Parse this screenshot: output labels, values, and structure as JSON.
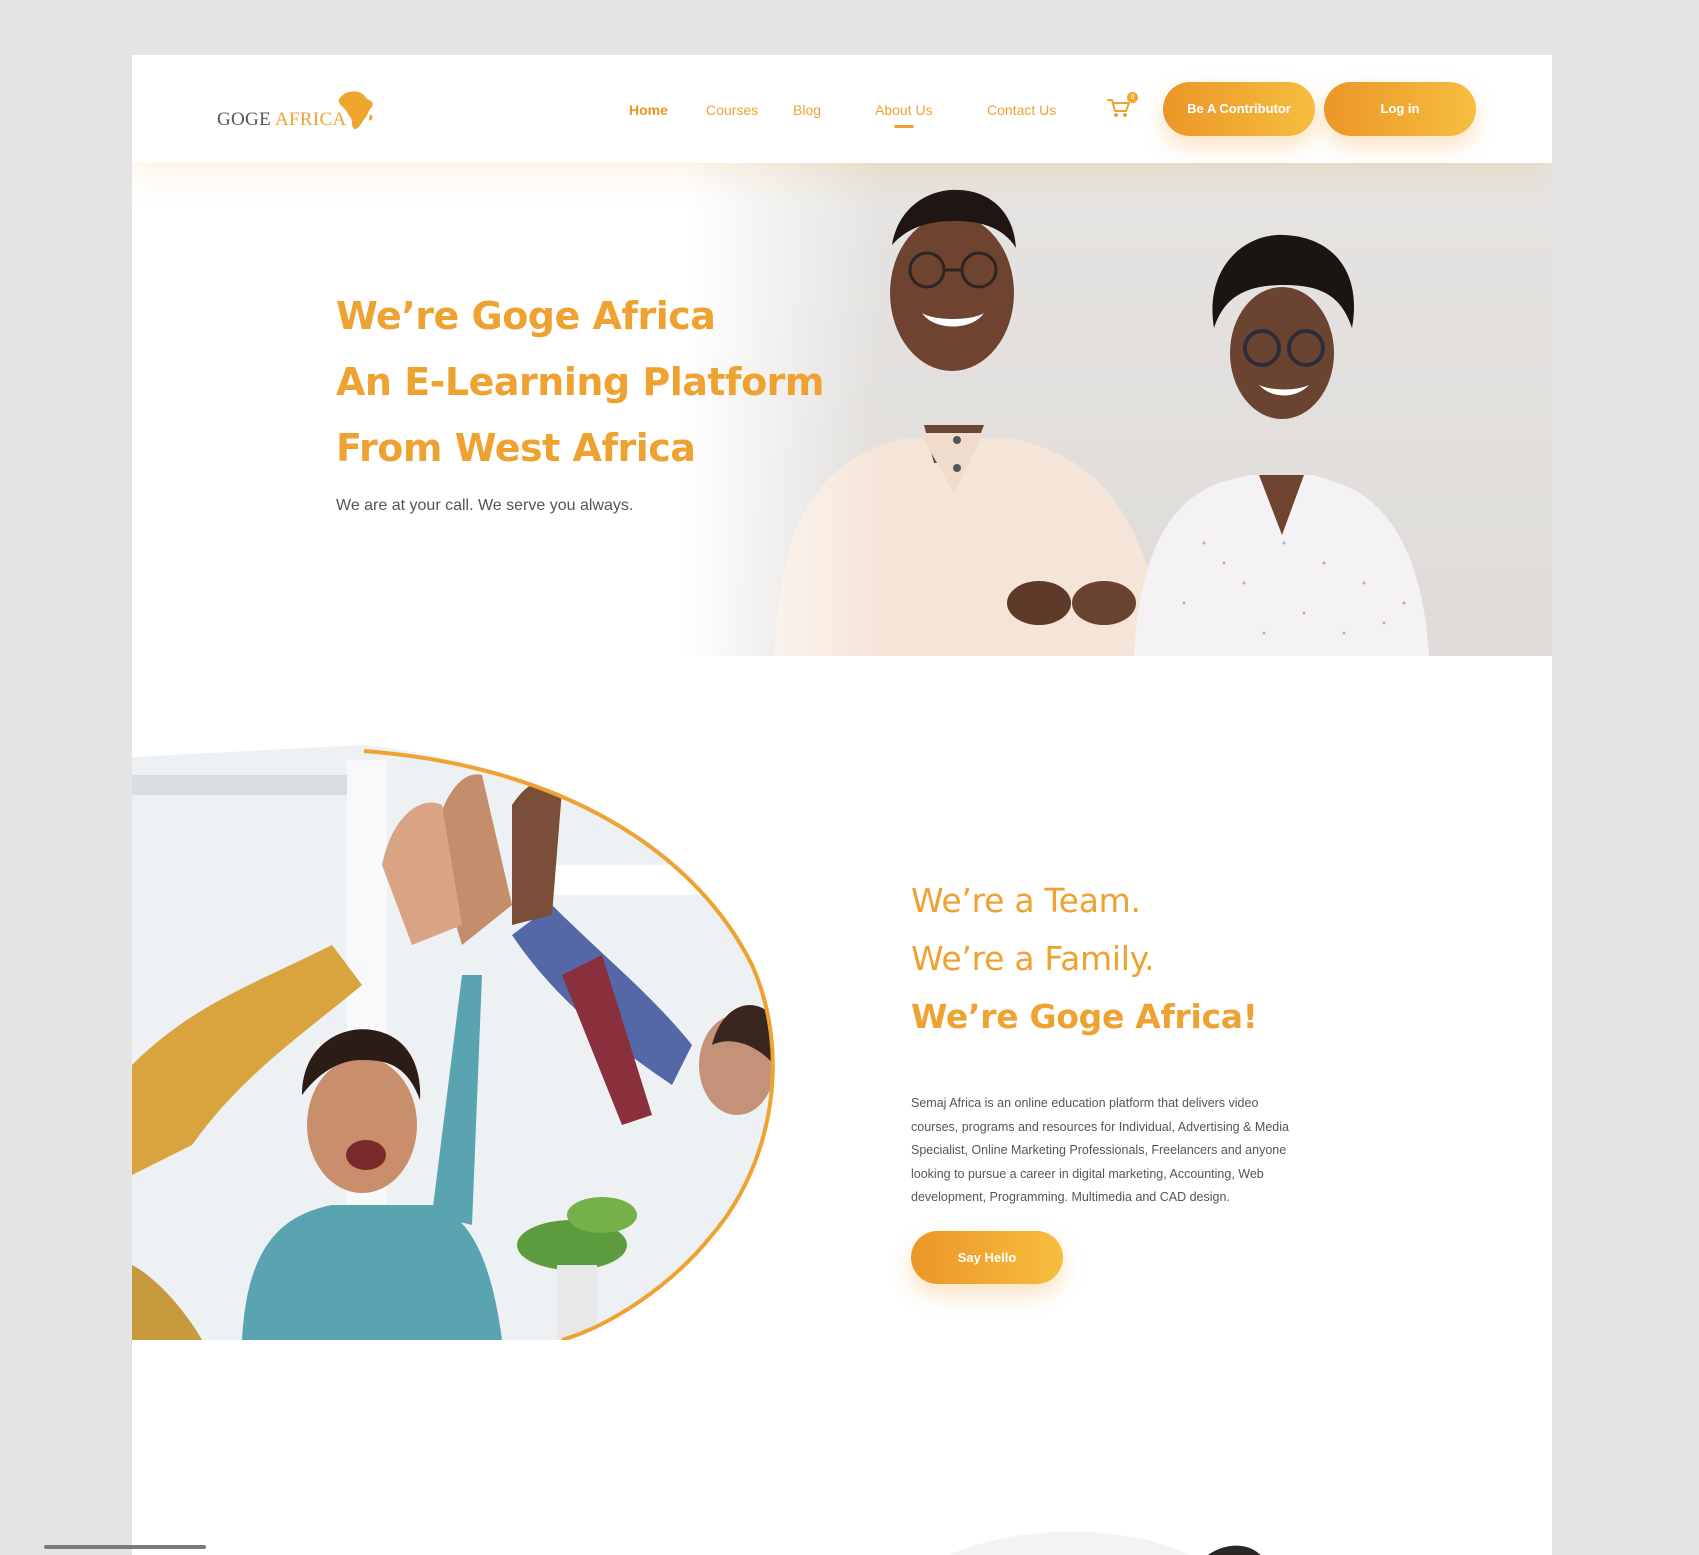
{
  "brand": {
    "logo_word1": "GOGE",
    "logo_word2": "AFRICA",
    "accent": "#eea232",
    "accent_dark": "#e9971f"
  },
  "nav": {
    "items": [
      {
        "label": "Home"
      },
      {
        "label": "Courses"
      },
      {
        "label": "Blog"
      },
      {
        "label": "About Us"
      },
      {
        "label": "Contact Us"
      }
    ],
    "cart_count": "0",
    "contributor_label": "Be A Contributor",
    "login_label": "Log in"
  },
  "hero": {
    "lines": [
      "We’re Goge Africa",
      "An E-Learning Platform",
      "From West Africa"
    ],
    "subtitle": "We are at your call. We serve you always."
  },
  "about": {
    "line1": "We’re a Team.",
    "line2": "We’re a Family.",
    "line3": "We’re Goge Africa!",
    "body": "Semaj Africa is an online education platform that delivers video courses, programs and resources for Individual, Advertising & Media Specialist, Online Marketing Professionals, Freelancers and anyone looking to pursue a career in digital marketing, Accounting, Web development, Programming. Multimedia and CAD design.",
    "cta_label": "Say Hello"
  }
}
